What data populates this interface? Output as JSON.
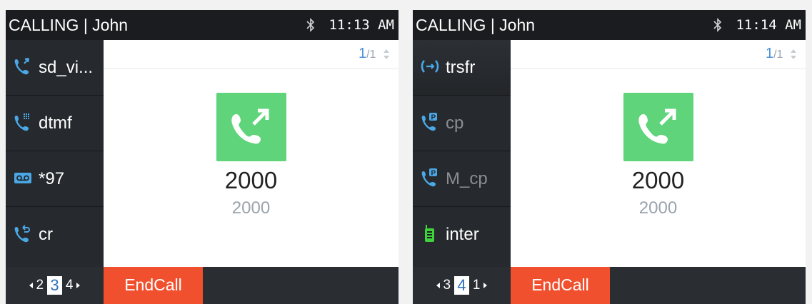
{
  "screens": [
    {
      "status": {
        "title": "CALLING | John",
        "time": "11:13 AM"
      },
      "sidebar": [
        {
          "label": "sd_vi...",
          "icon": "speed-dial-phone-icon",
          "dim": false
        },
        {
          "label": "dtmf",
          "icon": "dtmf-phone-icon",
          "dim": false
        },
        {
          "label": "*97",
          "icon": "voicemail-icon",
          "dim": false
        },
        {
          "label": "cr",
          "icon": "call-return-phone-icon",
          "dim": false
        }
      ],
      "pager": {
        "current": "1",
        "total": "/1"
      },
      "call": {
        "number": "2000",
        "sub": "2000"
      },
      "pageind": {
        "prev": "2",
        "current": "3",
        "next": "4"
      },
      "softkey": "EndCall"
    },
    {
      "status": {
        "title": "CALLING | John",
        "time": "11:14 AM"
      },
      "sidebar": [
        {
          "label": "trsfr",
          "icon": "transfer-icon",
          "dim": false
        },
        {
          "label": "cp",
          "icon": "call-park-phone-icon",
          "dim": true
        },
        {
          "label": "M_cp",
          "icon": "monitored-call-park-icon",
          "dim": true
        },
        {
          "label": "inter",
          "icon": "intercom-icon",
          "dim": false
        }
      ],
      "pager": {
        "current": "1",
        "total": "/1"
      },
      "call": {
        "number": "2000",
        "sub": "2000"
      },
      "pageind": {
        "prev": "3",
        "current": "4",
        "next": "1"
      },
      "softkey": "EndCall"
    }
  ],
  "colors": {
    "accent_blue": "#4a90d9",
    "call_green": "#5fd47a",
    "endcall_red": "#f1502f",
    "intercom_green": "#3fd23c"
  }
}
